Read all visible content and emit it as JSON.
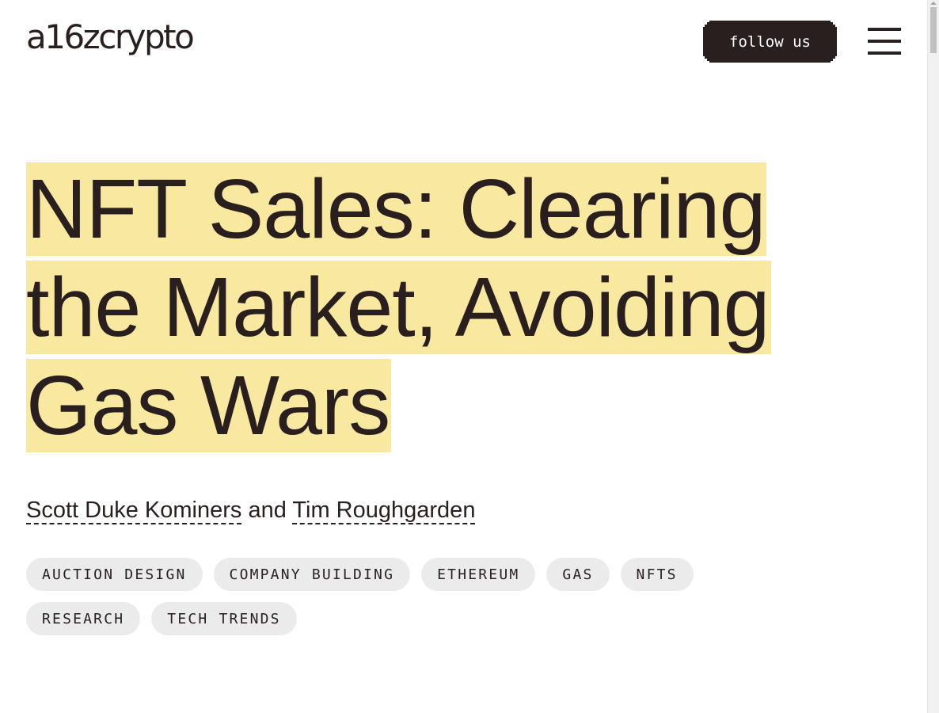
{
  "header": {
    "logo_text": "a16zcrypto",
    "follow_label": "follow us",
    "menu_icon": "hamburger-menu-icon"
  },
  "article": {
    "title": "NFT Sales: Clearing the Market, Avoiding Gas Wars",
    "authors": [
      {
        "name": "Scott Duke Kominers"
      },
      {
        "name": "Tim Roughgarden"
      }
    ],
    "author_conjunction": "and",
    "tags": [
      "AUCTION DESIGN",
      "COMPANY BUILDING",
      "ETHEREUM",
      "GAS",
      "NFTS",
      "RESEARCH",
      "TECH TRENDS"
    ]
  },
  "colors": {
    "text": "#2a1f1f",
    "highlight": "#f9e89f",
    "tag_background": "#ebebeb",
    "button_background": "#2a1f1f"
  }
}
